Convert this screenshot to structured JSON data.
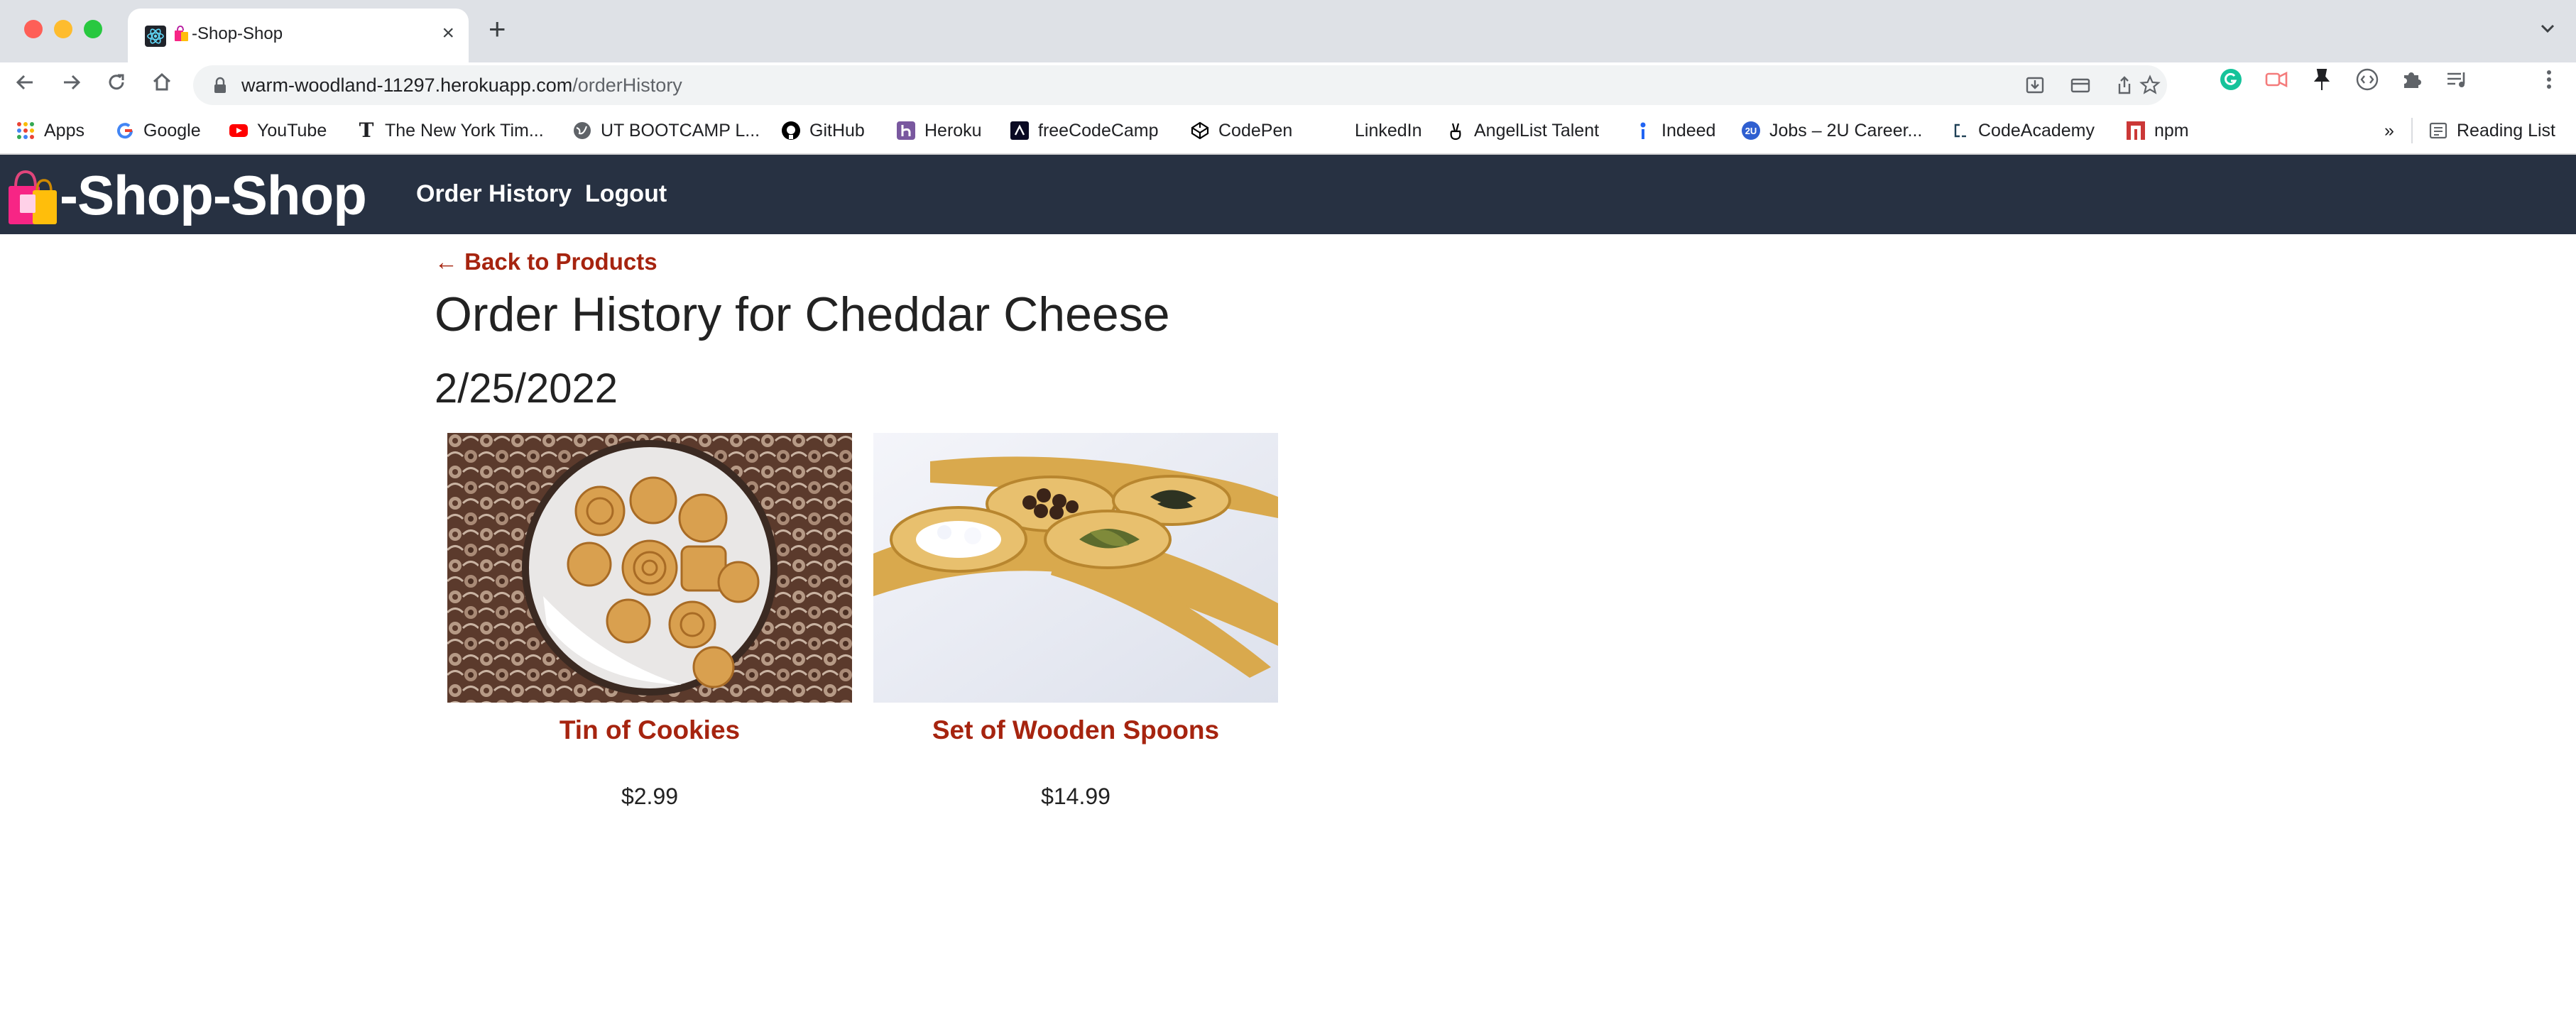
{
  "browser": {
    "tab_title": "-Shop-Shop",
    "url_domain": "warm-woodland-11297.herokuapp.com",
    "url_path": "/orderHistory",
    "bookmarks": [
      {
        "label": "Apps",
        "icon": "apps-grid-icon",
        "color": "#ea4335"
      },
      {
        "label": "Google",
        "icon": "google-icon",
        "color": "#4285f4"
      },
      {
        "label": "YouTube",
        "icon": "youtube-icon",
        "color": "#ff0000"
      },
      {
        "label": "The New York Tim...",
        "icon": "nyt-icon",
        "color": "#000000"
      },
      {
        "label": "UT BOOTCAMP L...",
        "icon": "globe-icon",
        "color": "#5f6368"
      },
      {
        "label": "GitHub",
        "icon": "github-icon",
        "color": "#000000"
      },
      {
        "label": "Heroku",
        "icon": "heroku-icon",
        "color": "#79589f"
      },
      {
        "label": "freeCodeCamp",
        "icon": "freecodecamp-icon",
        "color": "#0a0a23"
      },
      {
        "label": "CodePen",
        "icon": "codepen-icon",
        "color": "#000000"
      },
      {
        "label": "LinkedIn",
        "icon": "linkedin-icon",
        "color": "#ffffff"
      },
      {
        "label": "AngelList Talent",
        "icon": "angellist-icon",
        "color": "#000000"
      },
      {
        "label": "Indeed",
        "icon": "indeed-icon",
        "color": "#2164f3"
      },
      {
        "label": "Jobs – 2U Career...",
        "icon": "2u-icon",
        "color": "#2f5fd0"
      },
      {
        "label": "CodeAcademy",
        "icon": "codecademy-icon",
        "color": "#1f4056"
      },
      {
        "label": "npm",
        "icon": "npm-icon",
        "color": "#cb3837"
      }
    ],
    "overflow_label": "»",
    "reading_list_label": "Reading List"
  },
  "header": {
    "brand": "-Shop-Shop",
    "nav": [
      "Order History",
      "Logout"
    ]
  },
  "main": {
    "back_link": "← Back to Products",
    "title": "Order History for Cheddar Cheese",
    "orders": [
      {
        "date": "2/25/2022",
        "products": [
          {
            "name": "Tin of Cookies",
            "price": "$2.99",
            "image": "cookie-tin-image"
          },
          {
            "name": "Set of Wooden Spoons",
            "price": "$14.99",
            "image": "wooden-spoons-image"
          }
        ]
      }
    ]
  },
  "colors": {
    "header_bg": "#273142",
    "accent": "#a6240f",
    "tabstrip_bg": "#dee1e6"
  }
}
